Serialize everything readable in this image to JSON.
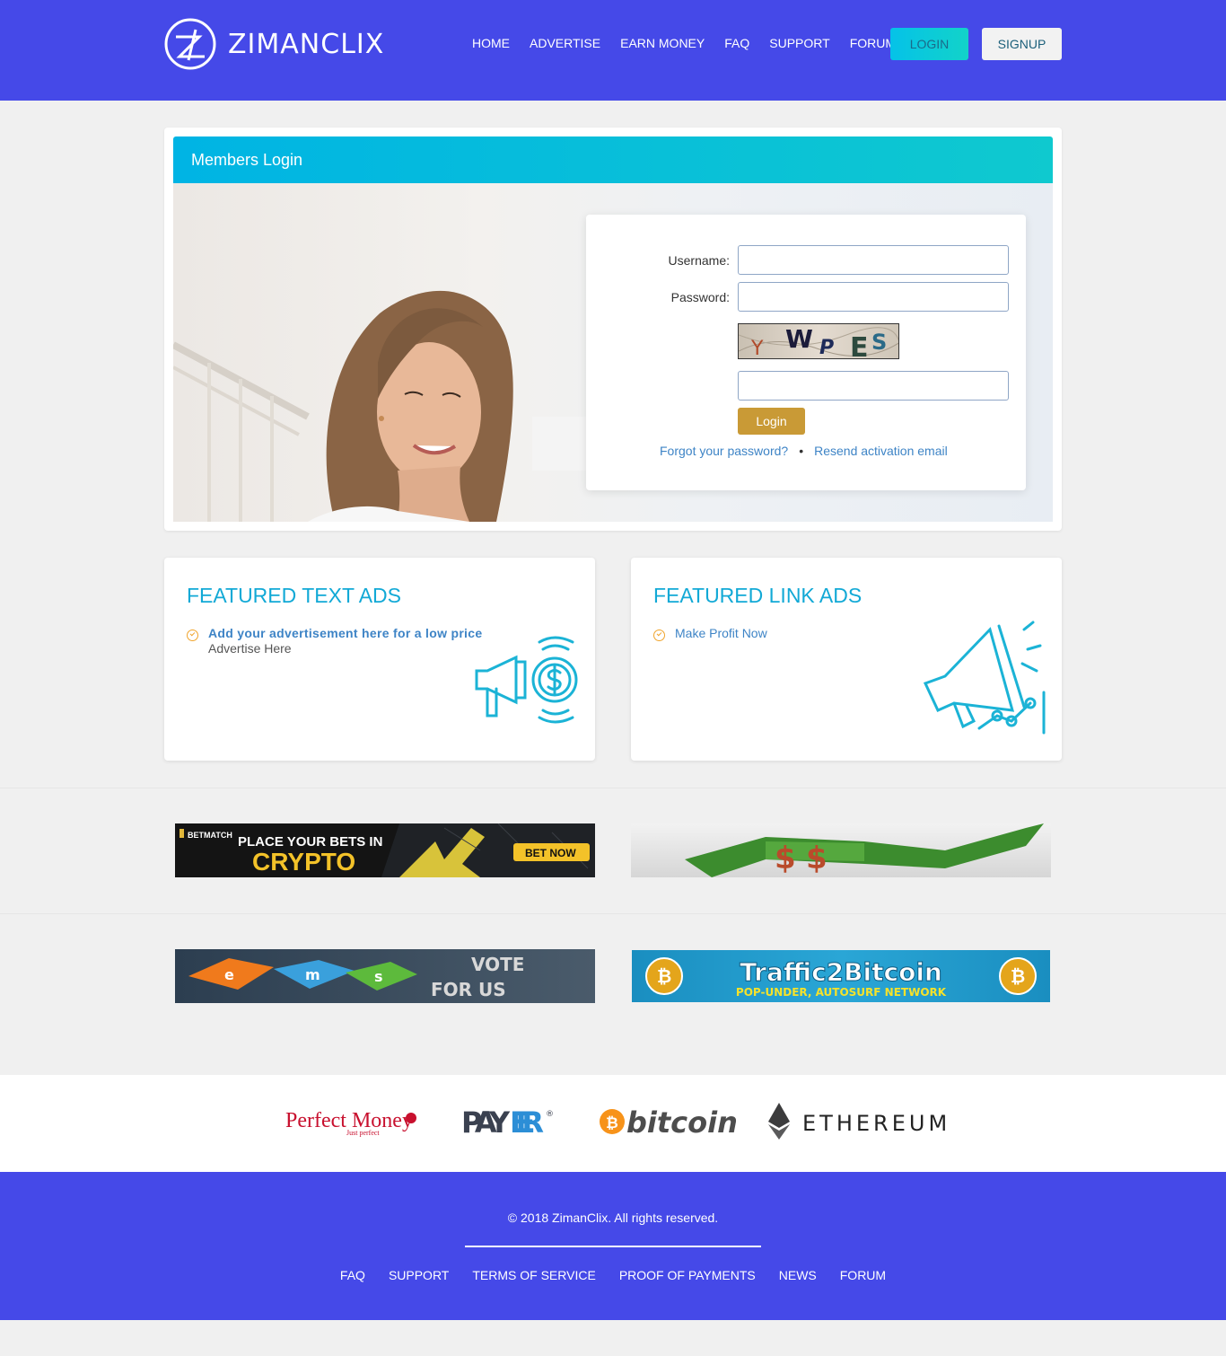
{
  "brand": {
    "name": "ZIMANCLIX"
  },
  "nav": {
    "items": [
      "HOME",
      "ADVERTISE",
      "EARN MONEY",
      "FAQ",
      "SUPPORT",
      "FORUM"
    ],
    "login": "LOGIN",
    "signup": "SIGNUP"
  },
  "login": {
    "title": "Members Login",
    "username_label": "Username:",
    "password_label": "Password:",
    "captcha_text": "YWPES",
    "button": "Login",
    "forgot": "Forgot your password?",
    "separator": "•",
    "resend": "Resend activation email"
  },
  "featured_text": {
    "title": "FEATURED TEXT ADS",
    "link": "Add your advertisement here for a low price",
    "sub": "Advertise Here"
  },
  "featured_link": {
    "title": "FEATURED LINK ADS",
    "link": "Make Profit Now"
  },
  "banners": {
    "betmatch": {
      "brand": "BETMATCH",
      "line1": "PLACE YOUR BETS IN",
      "line2": "CRYPTO",
      "cta": "BET NOW"
    },
    "ems": {
      "letters": [
        "e",
        "m",
        "s"
      ],
      "line1": "VOTE",
      "line2": "FOR US"
    },
    "traffic": {
      "title": "Traffic2Bitcoin",
      "sub": "POP-UNDER, AUTOSURF NETWORK"
    }
  },
  "payments": {
    "perfect_money": "Perfect Money",
    "perfect_money_tag": "Just perfect",
    "payeer_pay": "PAY",
    "payeer_eer": "EER",
    "bitcoin": "bitcoin",
    "ethereum": "ETHEREUM"
  },
  "footer": {
    "copyright": "© 2018 ZimanClix. All rights reserved.",
    "links": [
      "FAQ",
      "SUPPORT",
      "TERMS OF SERVICE",
      "PROOF OF PAYMENTS",
      "NEWS",
      "FORUM"
    ]
  },
  "colors": {
    "header": "#4549e8",
    "accent": "#12a9d6",
    "login_button": "#c99a36",
    "link": "#3e84c6"
  }
}
